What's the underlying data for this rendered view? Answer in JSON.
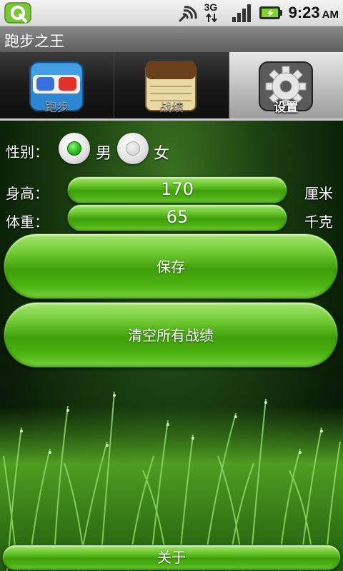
{
  "status_bar": {
    "icons": [
      "app-notification-icon",
      "wifi-icon",
      "3g-data-icon",
      "signal-icon",
      "battery-charging-icon"
    ],
    "network_label": "3G",
    "time": "9:23",
    "ampm": "AM"
  },
  "app": {
    "title": "跑步之王"
  },
  "tabs": [
    {
      "label": "跑步",
      "icon": "3d-glasses-icon",
      "active": false
    },
    {
      "label": "战绩",
      "icon": "notepad-icon",
      "active": false
    },
    {
      "label": "设置",
      "icon": "gear-icon",
      "active": true
    }
  ],
  "settings": {
    "gender": {
      "label": "性别：",
      "options": [
        {
          "label": "男",
          "checked": true
        },
        {
          "label": "女",
          "checked": false
        }
      ]
    },
    "height": {
      "label": "身高：",
      "value": "170",
      "unit": "厘米"
    },
    "weight": {
      "label": "体重：",
      "value": "65",
      "unit": "千克"
    }
  },
  "buttons": {
    "save": "保存",
    "clear": "清空所有战绩",
    "about": "关于"
  },
  "colors": {
    "accent_green": "#5cc21f",
    "radio_checked": "#23b514"
  }
}
